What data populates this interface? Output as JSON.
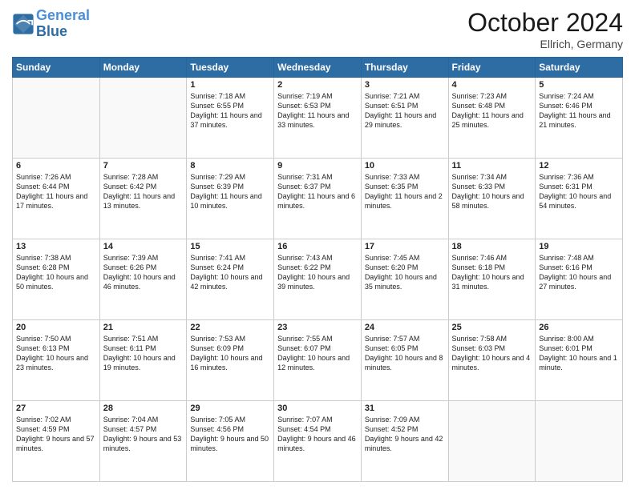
{
  "header": {
    "logo_line1": "General",
    "logo_line2": "Blue",
    "month": "October 2024",
    "location": "Ellrich, Germany"
  },
  "days_of_week": [
    "Sunday",
    "Monday",
    "Tuesday",
    "Wednesday",
    "Thursday",
    "Friday",
    "Saturday"
  ],
  "weeks": [
    [
      {
        "day": "",
        "info": ""
      },
      {
        "day": "",
        "info": ""
      },
      {
        "day": "1",
        "info": "Sunrise: 7:18 AM\nSunset: 6:55 PM\nDaylight: 11 hours and 37 minutes."
      },
      {
        "day": "2",
        "info": "Sunrise: 7:19 AM\nSunset: 6:53 PM\nDaylight: 11 hours and 33 minutes."
      },
      {
        "day": "3",
        "info": "Sunrise: 7:21 AM\nSunset: 6:51 PM\nDaylight: 11 hours and 29 minutes."
      },
      {
        "day": "4",
        "info": "Sunrise: 7:23 AM\nSunset: 6:48 PM\nDaylight: 11 hours and 25 minutes."
      },
      {
        "day": "5",
        "info": "Sunrise: 7:24 AM\nSunset: 6:46 PM\nDaylight: 11 hours and 21 minutes."
      }
    ],
    [
      {
        "day": "6",
        "info": "Sunrise: 7:26 AM\nSunset: 6:44 PM\nDaylight: 11 hours and 17 minutes."
      },
      {
        "day": "7",
        "info": "Sunrise: 7:28 AM\nSunset: 6:42 PM\nDaylight: 11 hours and 13 minutes."
      },
      {
        "day": "8",
        "info": "Sunrise: 7:29 AM\nSunset: 6:39 PM\nDaylight: 11 hours and 10 minutes."
      },
      {
        "day": "9",
        "info": "Sunrise: 7:31 AM\nSunset: 6:37 PM\nDaylight: 11 hours and 6 minutes."
      },
      {
        "day": "10",
        "info": "Sunrise: 7:33 AM\nSunset: 6:35 PM\nDaylight: 11 hours and 2 minutes."
      },
      {
        "day": "11",
        "info": "Sunrise: 7:34 AM\nSunset: 6:33 PM\nDaylight: 10 hours and 58 minutes."
      },
      {
        "day": "12",
        "info": "Sunrise: 7:36 AM\nSunset: 6:31 PM\nDaylight: 10 hours and 54 minutes."
      }
    ],
    [
      {
        "day": "13",
        "info": "Sunrise: 7:38 AM\nSunset: 6:28 PM\nDaylight: 10 hours and 50 minutes."
      },
      {
        "day": "14",
        "info": "Sunrise: 7:39 AM\nSunset: 6:26 PM\nDaylight: 10 hours and 46 minutes."
      },
      {
        "day": "15",
        "info": "Sunrise: 7:41 AM\nSunset: 6:24 PM\nDaylight: 10 hours and 42 minutes."
      },
      {
        "day": "16",
        "info": "Sunrise: 7:43 AM\nSunset: 6:22 PM\nDaylight: 10 hours and 39 minutes."
      },
      {
        "day": "17",
        "info": "Sunrise: 7:45 AM\nSunset: 6:20 PM\nDaylight: 10 hours and 35 minutes."
      },
      {
        "day": "18",
        "info": "Sunrise: 7:46 AM\nSunset: 6:18 PM\nDaylight: 10 hours and 31 minutes."
      },
      {
        "day": "19",
        "info": "Sunrise: 7:48 AM\nSunset: 6:16 PM\nDaylight: 10 hours and 27 minutes."
      }
    ],
    [
      {
        "day": "20",
        "info": "Sunrise: 7:50 AM\nSunset: 6:13 PM\nDaylight: 10 hours and 23 minutes."
      },
      {
        "day": "21",
        "info": "Sunrise: 7:51 AM\nSunset: 6:11 PM\nDaylight: 10 hours and 19 minutes."
      },
      {
        "day": "22",
        "info": "Sunrise: 7:53 AM\nSunset: 6:09 PM\nDaylight: 10 hours and 16 minutes."
      },
      {
        "day": "23",
        "info": "Sunrise: 7:55 AM\nSunset: 6:07 PM\nDaylight: 10 hours and 12 minutes."
      },
      {
        "day": "24",
        "info": "Sunrise: 7:57 AM\nSunset: 6:05 PM\nDaylight: 10 hours and 8 minutes."
      },
      {
        "day": "25",
        "info": "Sunrise: 7:58 AM\nSunset: 6:03 PM\nDaylight: 10 hours and 4 minutes."
      },
      {
        "day": "26",
        "info": "Sunrise: 8:00 AM\nSunset: 6:01 PM\nDaylight: 10 hours and 1 minute."
      }
    ],
    [
      {
        "day": "27",
        "info": "Sunrise: 7:02 AM\nSunset: 4:59 PM\nDaylight: 9 hours and 57 minutes."
      },
      {
        "day": "28",
        "info": "Sunrise: 7:04 AM\nSunset: 4:57 PM\nDaylight: 9 hours and 53 minutes."
      },
      {
        "day": "29",
        "info": "Sunrise: 7:05 AM\nSunset: 4:56 PM\nDaylight: 9 hours and 50 minutes."
      },
      {
        "day": "30",
        "info": "Sunrise: 7:07 AM\nSunset: 4:54 PM\nDaylight: 9 hours and 46 minutes."
      },
      {
        "day": "31",
        "info": "Sunrise: 7:09 AM\nSunset: 4:52 PM\nDaylight: 9 hours and 42 minutes."
      },
      {
        "day": "",
        "info": ""
      },
      {
        "day": "",
        "info": ""
      }
    ]
  ]
}
